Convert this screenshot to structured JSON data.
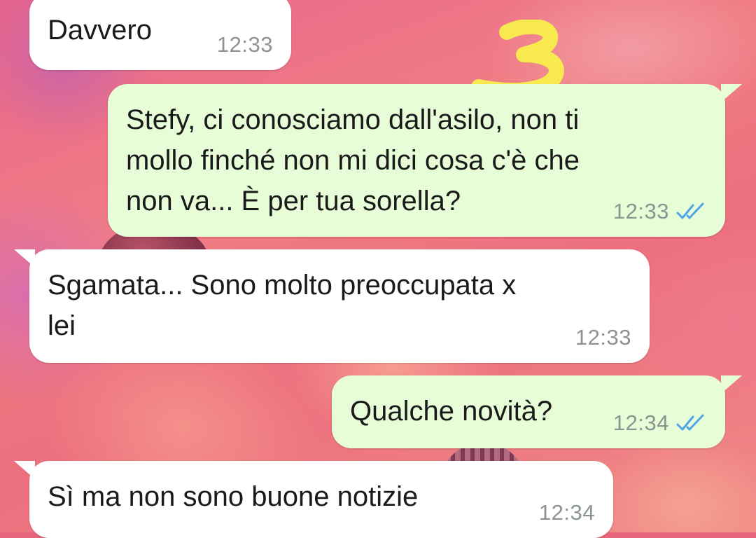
{
  "sticker": {
    "label": "3",
    "color": "#f7e94e"
  },
  "messages": [
    {
      "direction": "incoming",
      "text": "Davvero",
      "time": "12:33"
    },
    {
      "direction": "outgoing",
      "text": "Stefy, ci conosciamo dall'asilo, non ti\nmollo finché non mi dici cosa c'è che\nnon va... È per tua sorella?",
      "time": "12:33",
      "read_receipt": "double-check-read"
    },
    {
      "direction": "incoming",
      "text": "Sgamata... Sono molto preoccupata x\nlei",
      "time": "12:33"
    },
    {
      "direction": "outgoing",
      "text": "Qualche novità?",
      "time": "12:34",
      "read_receipt": "double-check-read"
    },
    {
      "direction": "incoming",
      "text": "Sì ma non sono buone notizie",
      "time": "12:34"
    }
  ],
  "colors": {
    "incoming_bubble": "#ffffff",
    "outgoing_bubble": "#e6fdd7",
    "timestamp": "#8c948f",
    "read_tick": "#4fa3e8"
  }
}
